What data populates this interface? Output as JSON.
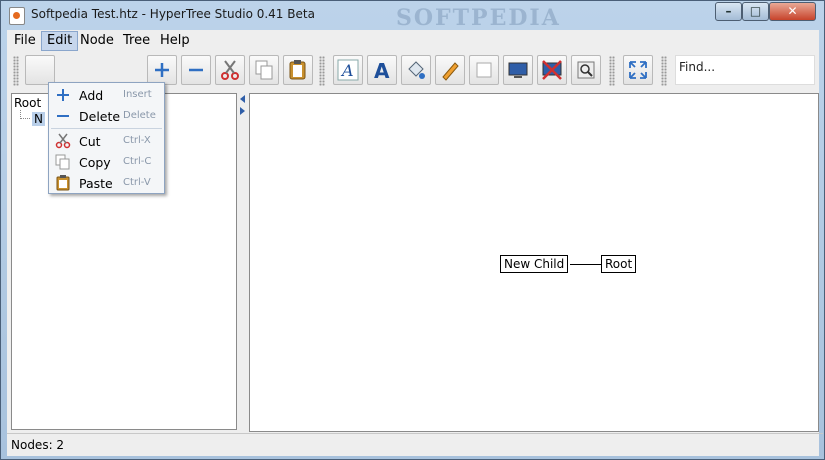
{
  "window": {
    "title": "Softpedia Test.htz - HyperTree Studio 0.41 Beta",
    "watermark": "SOFTPEDIA",
    "controls": {
      "min": "–",
      "max": "□",
      "close": "✕"
    }
  },
  "menubar": {
    "items": [
      "File",
      "Edit",
      "Node",
      "Tree",
      "Help"
    ],
    "active": "Edit"
  },
  "toolbar": {
    "find_label": "Find..."
  },
  "edit_menu": {
    "items": [
      {
        "label": "Add",
        "shortcut": "Insert",
        "icon": "plus-icon"
      },
      {
        "label": "Delete",
        "shortcut": "Delete",
        "icon": "minus-icon"
      },
      {
        "label": "Cut",
        "shortcut": "Ctrl-X",
        "icon": "scissors-icon"
      },
      {
        "label": "Copy",
        "shortcut": "Ctrl-C",
        "icon": "copy-icon"
      },
      {
        "label": "Paste",
        "shortcut": "Ctrl-V",
        "icon": "paste-icon"
      }
    ]
  },
  "tree": {
    "root": "Root",
    "child_abbrev": "N"
  },
  "canvas": {
    "nodes": [
      "New Child",
      "Root"
    ]
  },
  "status": {
    "text": "Nodes: 2"
  },
  "colors": {
    "accent_blue": "#2f6fc3",
    "selection": "#b9cfe9",
    "cut_red": "#d03030"
  }
}
